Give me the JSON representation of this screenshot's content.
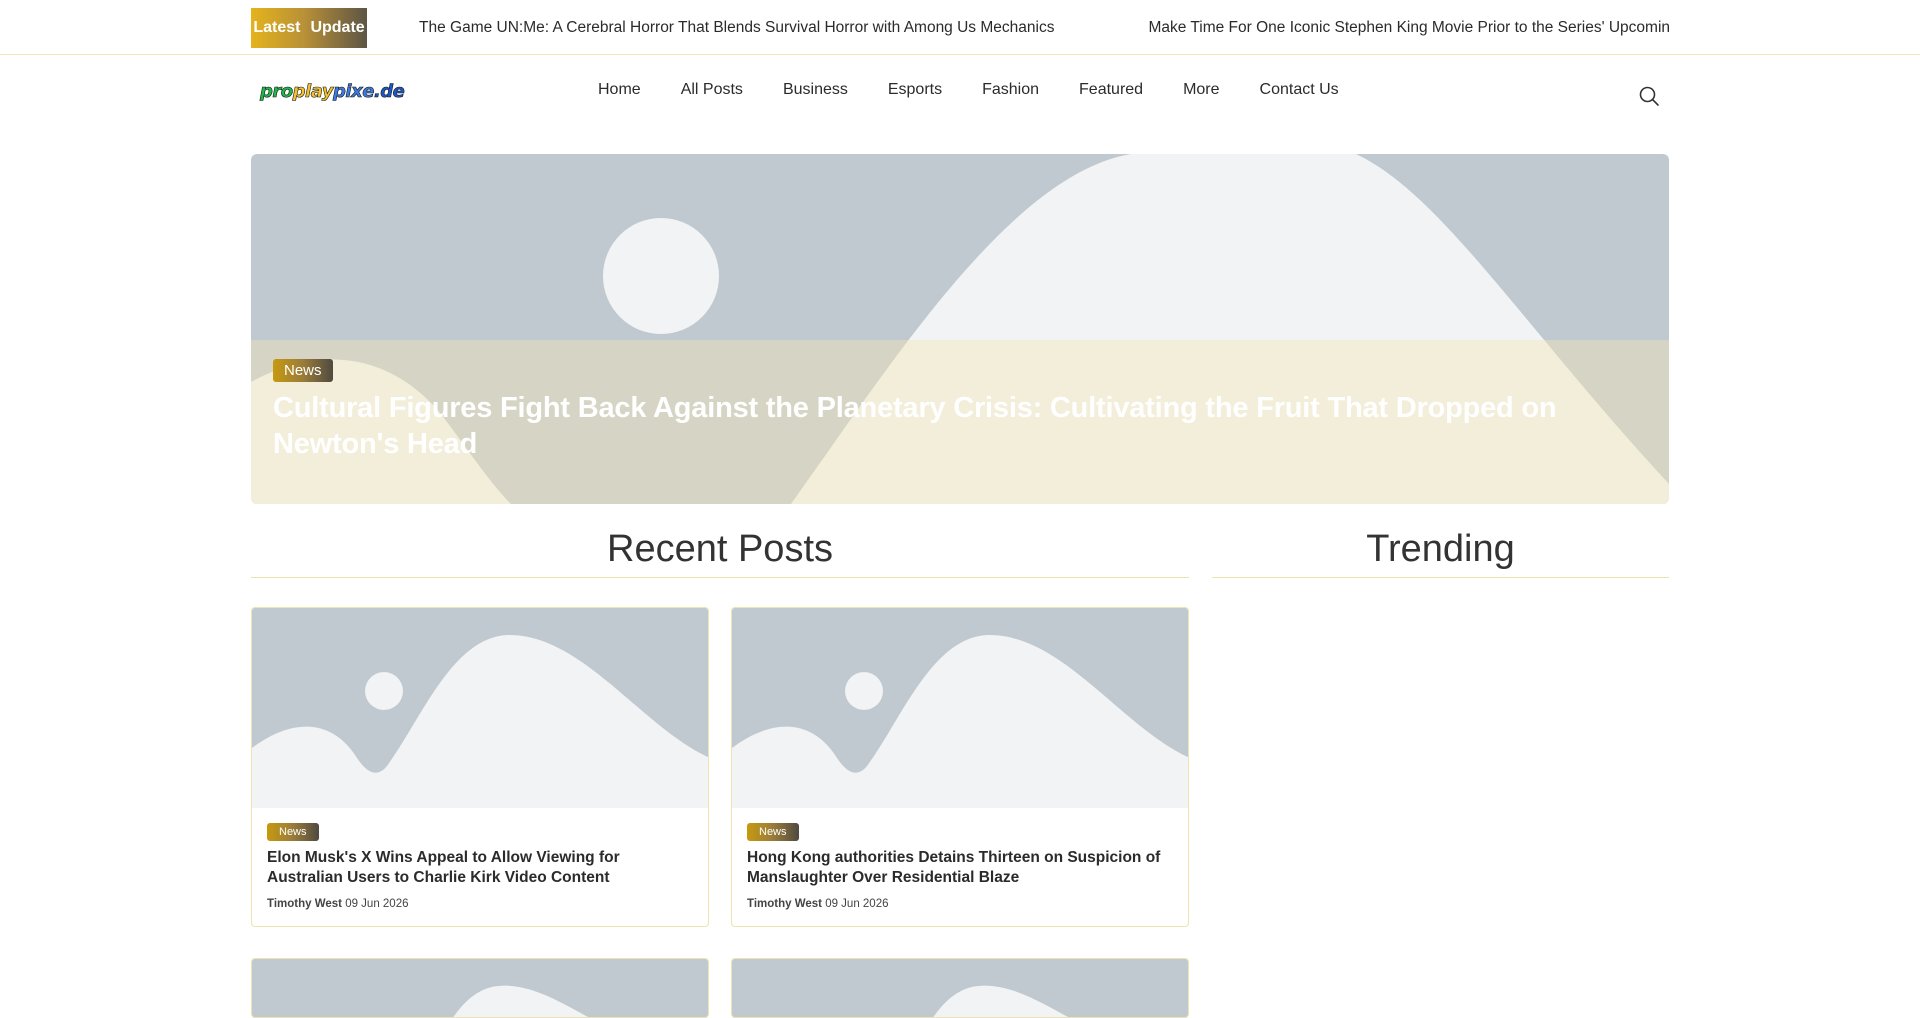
{
  "ticker": {
    "label_word1": "Latest",
    "label_word2": "Update",
    "items": [
      "The Game UN:Me: A Cerebral Horror That Blends Survival Horror with Among Us Mechanics",
      "Make Time For One Iconic Stephen King Movie Prior to the Series' Upcoming Ins"
    ]
  },
  "logo": {
    "part1": "pro",
    "part2": "play",
    "part3": "pixe",
    "part4": ".de"
  },
  "nav": {
    "items": [
      "Home",
      "All Posts",
      "Business",
      "Esports",
      "Fashion",
      "Featured",
      "More",
      "Contact Us"
    ]
  },
  "hero": {
    "category": "News",
    "title": "Cultural Figures Fight Back Against the Planetary Crisis: Cultivating the Fruit That Dropped on Newton's Head"
  },
  "sections": {
    "recent": "Recent Posts",
    "trending": "Trending"
  },
  "posts": [
    {
      "category": "News",
      "title": "Elon Musk's X Wins Appeal to Allow Viewing for Australian Users to Charlie Kirk Video Content",
      "author": "Timothy West",
      "date": "09 Jun 2026"
    },
    {
      "category": "News",
      "title": "Hong Kong authorities Detains Thirteen on Suspicion of Manslaughter Over Residential Blaze",
      "author": "Timothy West",
      "date": "09 Jun 2026"
    }
  ],
  "colors": {
    "accent_gold": "#e5b31c",
    "placeholder_sky": "#c1c9d0",
    "placeholder_hill": "#f1f3f4"
  },
  "icons": {
    "search": "search-icon",
    "image_placeholder": "image-placeholder-icon"
  }
}
